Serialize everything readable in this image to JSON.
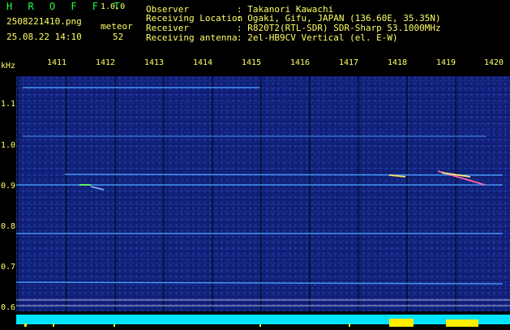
{
  "header": {
    "brand": "H R O F F T",
    "version": "1.0.0",
    "filename": "2508221410.png",
    "datetime": "25.08.22 14:10",
    "meteor_label": "meteor",
    "meteor_count": "52",
    "fields": [
      {
        "label": "Observer",
        "value": ": Takanori Kawachi"
      },
      {
        "label": "Receiving Location",
        "value": ": Ogaki, Gifu, JAPAN (136.60E, 35.35N)"
      },
      {
        "label": "Receiver",
        "value": ": R820T2(RTL-SDR) SDR-Sharp 53.1000MHz"
      },
      {
        "label": "Receiving antenna",
        "value": ": 2el-HB9CV Vertical (el. E-W)"
      }
    ]
  },
  "axis": {
    "unit": "kHz",
    "minute_ticks": [
      "1411",
      "1412",
      "1413",
      "1414",
      "1415",
      "1416",
      "1417",
      "1418",
      "1419",
      "1420"
    ],
    "freq_ticks": [
      "1.1",
      "1.0",
      "0.9",
      "0.8",
      "0.7",
      "0.6"
    ]
  },
  "colors": {
    "background": "#0b1a6e",
    "text": "#ffff66",
    "brand": "#22ff44",
    "bottom_bar": "#00e5ff"
  }
}
